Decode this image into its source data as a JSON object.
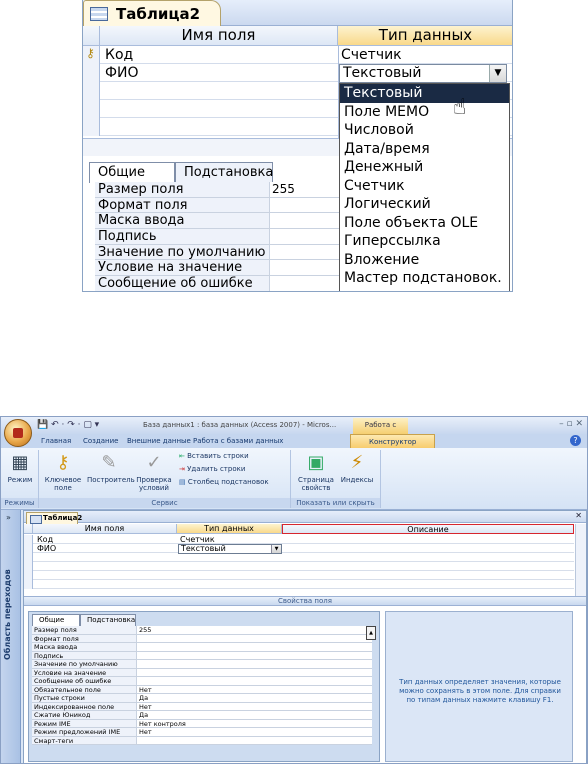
{
  "top": {
    "tab_title": "Таблица2",
    "col_name": "Имя поля",
    "col_type": "Тип данных",
    "rows": [
      {
        "name": "Код",
        "type": "Счетчик",
        "key": true
      },
      {
        "name": "ФИО",
        "type": "Текстовый",
        "key": false
      }
    ],
    "combo_value": "Текстовый",
    "dropdown": [
      "Текстовый",
      "Поле MEMO",
      "Числовой",
      "Дата/время",
      "Денежный",
      "Счетчик",
      "Логический",
      "Поле объекта OLE",
      "Гиперссылка",
      "Вложение",
      "Мастер подстановок."
    ],
    "dropdown_selected": 0,
    "prop_tabs": [
      "Общие",
      "Подстановка"
    ],
    "props": [
      "Размер поля",
      "Формат поля",
      "Маска ввода",
      "Подпись",
      "Значение по умолчанию",
      "Условие на значение",
      "Сообщение об ошибке"
    ],
    "size_value": "255"
  },
  "win": {
    "title": "База данных1 : база данных (Access 2007) - Micros...",
    "context_group": "Работа с таблицами",
    "tabs": [
      "Главная",
      "Создание",
      "Внешние данные",
      "Работа с базами данных",
      "Конструктор"
    ],
    "active_tab": "Конструктор",
    "ribbon": {
      "mode_label": "Режим",
      "mode_group": "Режимы",
      "key_field": "Ключевое поле",
      "builder": "Построитель",
      "check_conditions": "Проверка условий",
      "insert_rows": "Вставить строки",
      "delete_rows": "Удалить строки",
      "lookup_column": "Столбец подстановок",
      "service_group": "Сервис",
      "property_sheet": "Страница свойств",
      "indexes": "Индексы",
      "show_hide_group": "Показать или скрыть"
    },
    "nav_pane": "Область переходов",
    "doc_tab": "Таблица2",
    "col_name": "Имя поля",
    "col_type": "Тип данных",
    "col_desc": "Описание",
    "rows": [
      {
        "name": "Код",
        "type": "Счетчик"
      },
      {
        "name": "ФИО",
        "type": "Текстовый"
      }
    ],
    "field_props_title": "Свойства поля",
    "prop_tabs": [
      "Общие",
      "Подстановка"
    ],
    "props": [
      [
        "Размер поля",
        "255"
      ],
      [
        "Формат поля",
        ""
      ],
      [
        "Маска ввода",
        ""
      ],
      [
        "Подпись",
        ""
      ],
      [
        "Значение по умолчанию",
        ""
      ],
      [
        "Условие на значение",
        ""
      ],
      [
        "Сообщение об ошибке",
        ""
      ],
      [
        "Обязательное поле",
        "Нет"
      ],
      [
        "Пустые строки",
        "Да"
      ],
      [
        "Индексированное поле",
        "Нет"
      ],
      [
        "Сжатие Юникод",
        "Да"
      ],
      [
        "Режим IME",
        "Нет контроля"
      ],
      [
        "Режим предложений IME",
        "Нет"
      ],
      [
        "Смарт-теги",
        ""
      ]
    ],
    "help_text": "Тип данных определяет значения, которые можно сохранять в этом поле.  Для справки по типам данных нажмите клавишу F1."
  }
}
